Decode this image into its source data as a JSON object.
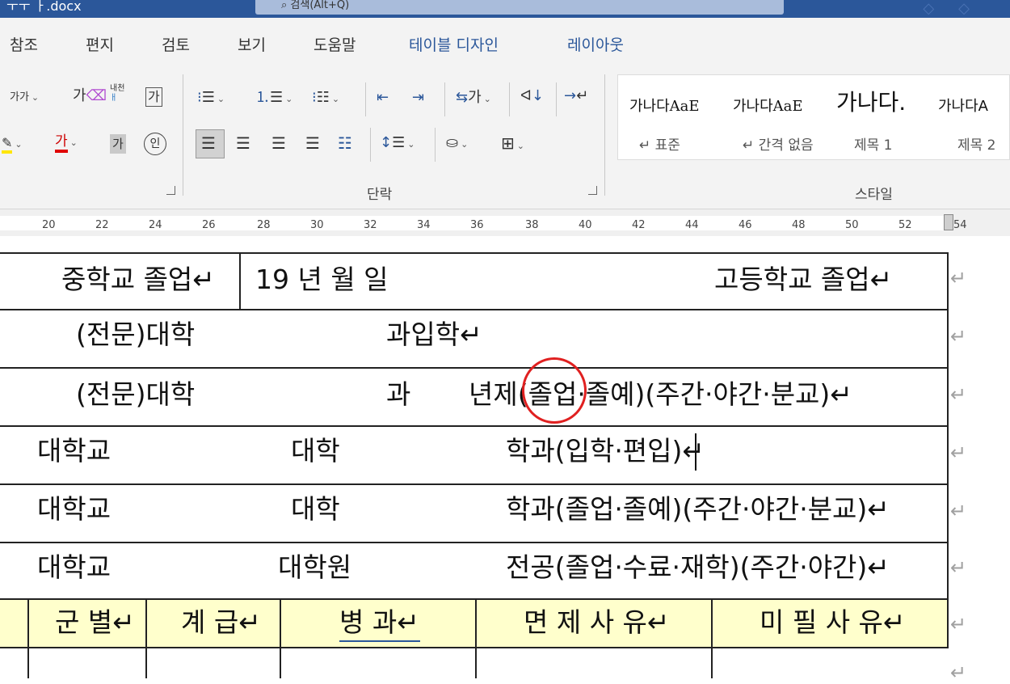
{
  "window": {
    "doc_title_fragment": "ㅜㅜ ㅏ.docx",
    "search_fragment": "⌕ 검색(Alt+Q)"
  },
  "tabs": [
    {
      "label": "참조"
    },
    {
      "label": "편지"
    },
    {
      "label": "검토"
    },
    {
      "label": "보기"
    },
    {
      "label": "도움말"
    },
    {
      "label": "테이블 디자인"
    },
    {
      "label": "레이아웃"
    }
  ],
  "ribbon": {
    "font": {
      "size_label": "가가",
      "highlight_icon": "가",
      "font_color_icon": "가",
      "char_shade": "가",
      "enclose": "인",
      "phonetic": "내천",
      "charborder": "가"
    },
    "paragraph_label": "단락",
    "styles_label": "스타일",
    "styles": [
      {
        "preview": "가나다AaE",
        "name": "↵ 표준"
      },
      {
        "preview": "가나다AaE",
        "name": "↵ 간격 없음"
      },
      {
        "preview": "가나다.",
        "name": "제목 1"
      },
      {
        "preview": "가나다A",
        "name": "제목 2"
      }
    ]
  },
  "ruler": {
    "ticks": [
      "20",
      "22",
      "24",
      "26",
      "28",
      "30",
      "32",
      "34",
      "36",
      "38",
      "40",
      "42",
      "44",
      "46",
      "48",
      "50",
      "52",
      "54"
    ]
  },
  "document": {
    "row1": {
      "left": "중학교 졸업↵",
      "date": "19    년    월    일",
      "right": "고등학교 졸업↵"
    },
    "row2": {
      "a": "(전문)대학",
      "b": "과입학↵"
    },
    "row3": {
      "a": "(전문)대학",
      "b": "과",
      "c": "년제(졸업·졸예)(주간·야간·분교)↵"
    },
    "row4": {
      "a": "대학교",
      "b": "대학",
      "c": "학과(입학·편입)↵"
    },
    "row5": {
      "a": "대학교",
      "b": "대학",
      "c": "학과(졸업·졸예)(주간·야간·분교)↵"
    },
    "row6": {
      "a": "대학교",
      "b": "대학원",
      "c": "전공(졸업·수료·재학)(주간·야간)↵"
    },
    "header": [
      {
        "label": "군 별↵"
      },
      {
        "label": "계 급↵"
      },
      {
        "label": "병 과↵"
      },
      {
        "label": "면 제 사 유↵"
      },
      {
        "label": "미 필 사 유↵"
      }
    ],
    "paragraph_mark": "↵"
  }
}
